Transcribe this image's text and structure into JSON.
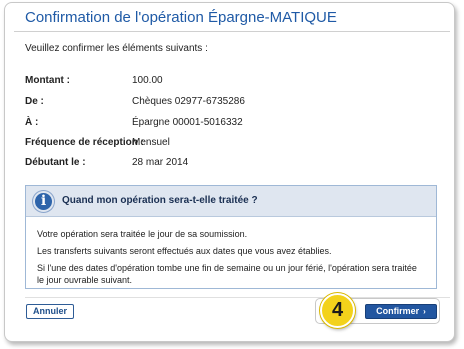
{
  "page": {
    "title": "Confirmation de l'opération Épargne-MATIQUE",
    "intro": "Veuillez confirmer les éléments suivants :"
  },
  "details": [
    {
      "label": "Montant :",
      "value": "100.00"
    },
    {
      "label": "De :",
      "value": "Chèques 02977-6735286"
    },
    {
      "label": "À :",
      "value": "Épargne 00001-5016332"
    },
    {
      "label": "Fréquence de réception :",
      "value": "Mensuel"
    },
    {
      "label": "Débutant le :",
      "value": "28 mar 2014"
    }
  ],
  "info": {
    "icon": "info-icon",
    "icon_glyph": "i",
    "title": "Quand mon opération sera-t-elle traitée ?",
    "lines": [
      "Votre opération sera traitée le jour de sa soumission.",
      "Les transferts suivants seront effectués aux dates que vous avez établies.",
      "Si l'une des dates d'opération tombe une fin de semaine ou un jour férié, l'opération sera traitée le jour ouvrable suivant."
    ]
  },
  "actions": {
    "cancel_label": "Annuler",
    "confirm_label": "Confirmer",
    "confirm_arrow": "›",
    "step_number": "4"
  },
  "colors": {
    "title": "#1f5aa6",
    "primary_button": "#2256a0",
    "info_header": "#dfe6f0",
    "step_badge": "#f3d21b"
  }
}
